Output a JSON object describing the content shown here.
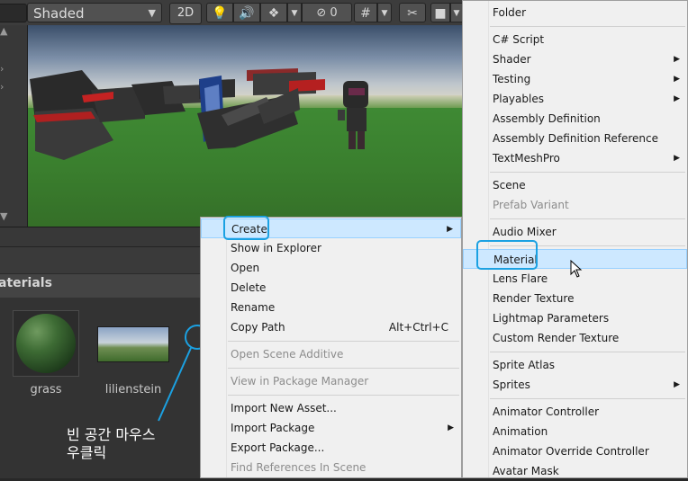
{
  "toolbar": {
    "shading_mode": "Shaded",
    "dimension_toggle": "2D",
    "hidden_count": "0"
  },
  "project": {
    "folder_header": "aterials",
    "assets": [
      {
        "name": "grass"
      },
      {
        "name": "lilienstein"
      }
    ]
  },
  "annotation": {
    "text": "빈 공간 마우스\n우클릭",
    "color": "#1ba1e2"
  },
  "context_menu": {
    "items": [
      {
        "label": "Create",
        "highlighted": true,
        "submenu": true
      },
      {
        "label": "Show in Explorer"
      },
      {
        "label": "Open"
      },
      {
        "label": "Delete"
      },
      {
        "label": "Rename"
      },
      {
        "label": "Copy Path",
        "shortcut": "Alt+Ctrl+C"
      },
      {
        "label": "Open Scene Additive",
        "disabled": true
      },
      {
        "label": "View in Package Manager",
        "disabled": true
      },
      {
        "label": "Import New Asset..."
      },
      {
        "label": "Import Package",
        "submenu": true
      },
      {
        "label": "Export Package..."
      },
      {
        "label": "Find References In Scene",
        "disabled": true
      }
    ]
  },
  "create_submenu": {
    "items": [
      {
        "label": "Folder"
      },
      {
        "label": "C# Script"
      },
      {
        "label": "Shader",
        "submenu": true
      },
      {
        "label": "Testing",
        "submenu": true
      },
      {
        "label": "Playables",
        "submenu": true
      },
      {
        "label": "Assembly Definition"
      },
      {
        "label": "Assembly Definition Reference"
      },
      {
        "label": "TextMeshPro",
        "submenu": true
      },
      {
        "label": "Scene"
      },
      {
        "label": "Prefab Variant",
        "disabled": true
      },
      {
        "label": "Audio Mixer"
      },
      {
        "label": "Material",
        "highlighted": true
      },
      {
        "label": "Lens Flare"
      },
      {
        "label": "Render Texture"
      },
      {
        "label": "Lightmap Parameters"
      },
      {
        "label": "Custom Render Texture"
      },
      {
        "label": "Sprite Atlas"
      },
      {
        "label": "Sprites",
        "submenu": true
      },
      {
        "label": "Animator Controller"
      },
      {
        "label": "Animation"
      },
      {
        "label": "Animator Override Controller"
      },
      {
        "label": "Avatar Mask"
      }
    ]
  }
}
